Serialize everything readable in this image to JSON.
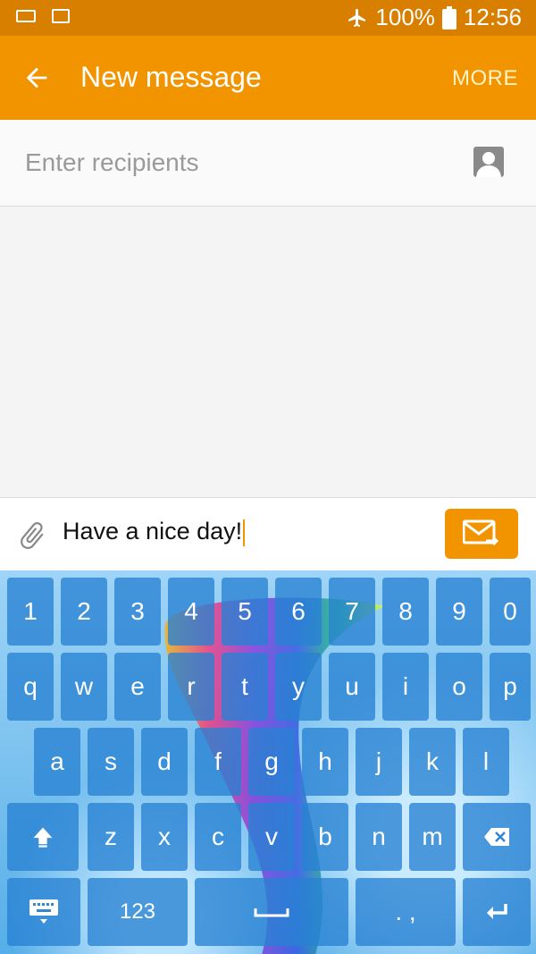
{
  "status_bar": {
    "battery": "100%",
    "time": "12:56"
  },
  "app_bar": {
    "title": "New message",
    "more": "MORE"
  },
  "recipients": {
    "placeholder": "Enter recipients"
  },
  "compose": {
    "text": "Have a nice day!"
  },
  "keyboard": {
    "row_numbers": [
      "1",
      "2",
      "3",
      "4",
      "5",
      "6",
      "7",
      "8",
      "9",
      "0"
    ],
    "row_q": [
      "q",
      "w",
      "e",
      "r",
      "t",
      "y",
      "u",
      "i",
      "o",
      "p"
    ],
    "row_a": [
      "a",
      "s",
      "d",
      "f",
      "g",
      "h",
      "j",
      "k",
      "l"
    ],
    "row_z": [
      "z",
      "x",
      "c",
      "v",
      "b",
      "n",
      "m"
    ],
    "bottom": {
      "numbers": "123",
      "punct": ". ,"
    }
  },
  "colors": {
    "accent": "#f29400",
    "status_bar": "#d97f00",
    "key": "#2882d2"
  },
  "icons": [
    "keyboard-icon",
    "image-icon",
    "airplane-icon",
    "battery-icon",
    "back-arrow-icon",
    "contact-icon",
    "attach-icon",
    "send-icon",
    "shift-icon",
    "backspace-icon",
    "enter-icon",
    "keyboard-settings-icon"
  ]
}
